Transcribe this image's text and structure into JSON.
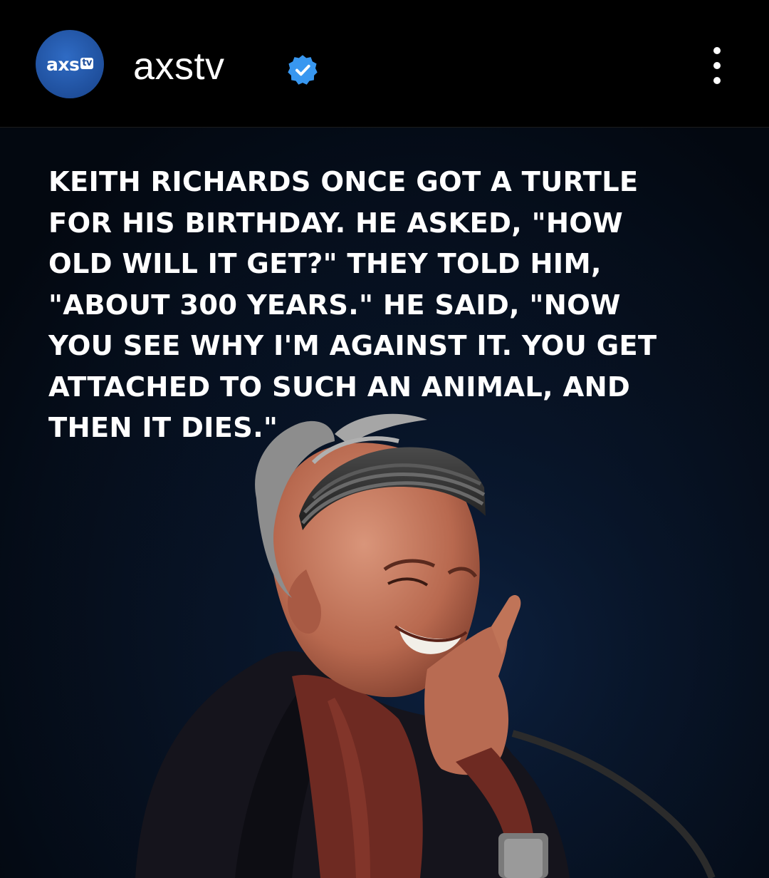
{
  "account": {
    "avatar_text": "axs",
    "avatar_badge": "tv",
    "username": "axstv",
    "verified": true
  },
  "header": {
    "more_icon": "more-vertical-icon"
  },
  "post": {
    "caption_lines": [
      "KEITH RICHARDS ONCE GOT A TURTLE",
      "FOR HIS BIRTHDAY. HE ASKED, \"HOW",
      "OLD WILL IT GET?\" THEY TOLD HIM,",
      "\"ABOUT 300 YEARS.\" HE SAID, \"NOW",
      "YOU SEE WHY I'M AGAINST IT. YOU GET",
      "ATTACHED TO SUCH AN ANIMAL, AND",
      "THEN IT DIES.\""
    ]
  },
  "colors": {
    "background": "#000000",
    "avatar_blue": "#1f4f9c",
    "verified_blue": "#3897f0",
    "post_background": "#071223"
  }
}
